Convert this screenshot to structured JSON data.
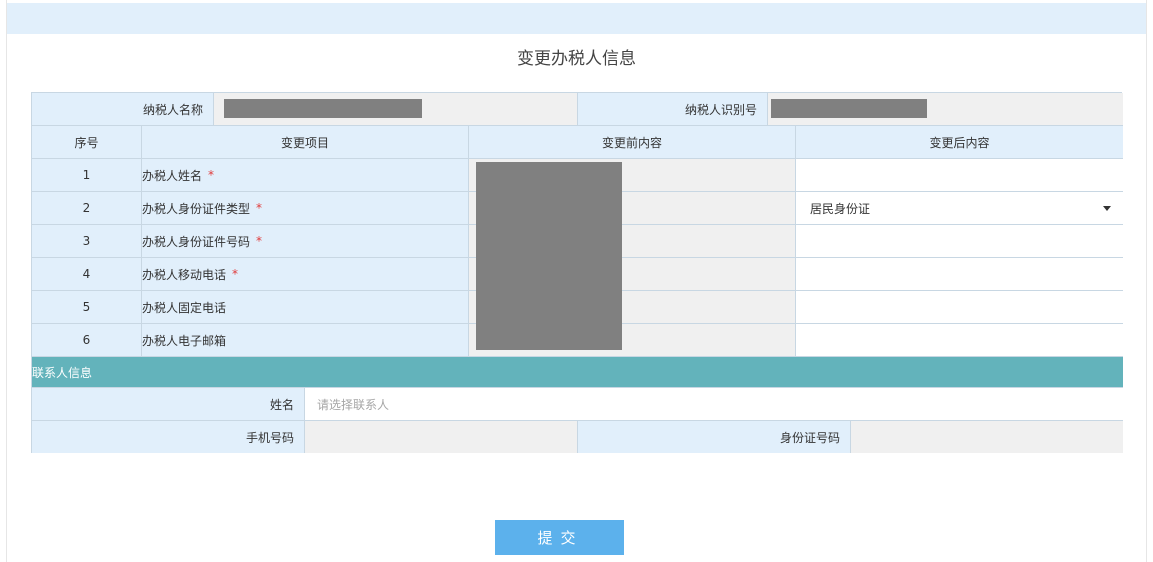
{
  "form": {
    "title": "变更办税人信息",
    "taxpayer_name_label": "纳税人名称",
    "taxpayer_id_label": "纳税人识别号",
    "headers": {
      "seq": "序号",
      "item": "变更项目",
      "before": "变更前内容",
      "after": "变更后内容"
    },
    "rows": [
      {
        "seq": "1",
        "label": "办税人姓名",
        "required": "*",
        "after": ""
      },
      {
        "seq": "2",
        "label": "办税人身份证件类型",
        "required": "*",
        "after": "居民身份证"
      },
      {
        "seq": "3",
        "label": "办税人身份证件号码",
        "required": "*",
        "after": ""
      },
      {
        "seq": "4",
        "label": "办税人移动电话",
        "required": "*",
        "after": ""
      },
      {
        "seq": "5",
        "label": "办税人固定电话",
        "required": "",
        "after": ""
      },
      {
        "seq": "6",
        "label": "办税人电子邮箱",
        "required": "",
        "after": ""
      }
    ],
    "contact": {
      "section_title": "联系人信息",
      "name_label": "姓名",
      "name_placeholder": "请选择联系人",
      "mobile_label": "手机号码",
      "mobile_value": "",
      "id_label": "身份证号码",
      "id_value": ""
    },
    "submit_label": "提交"
  },
  "colors": {
    "header_bg": "#e1effb",
    "section_bg": "#63b3bb",
    "readonly_bg": "#f0f0f0",
    "button_bg": "#5cb1ec",
    "required": "#e03a3a",
    "redaction": "#808080"
  }
}
